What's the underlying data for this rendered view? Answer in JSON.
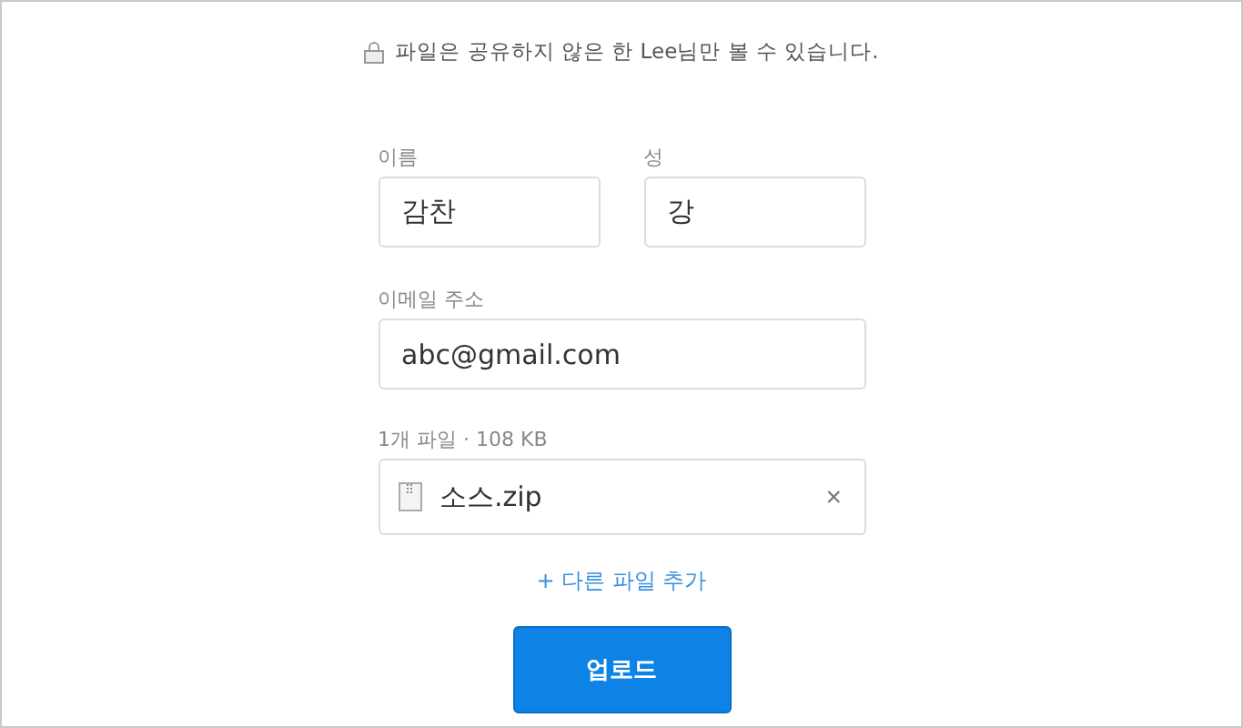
{
  "notice": "파일은 공유하지 않은 한 Lee님만 볼 수 있습니다.",
  "name_fields": [
    {
      "label": "이름",
      "value": "감찬"
    },
    {
      "label": "성",
      "value": "강"
    }
  ],
  "email_field": {
    "label": "이메일 주소",
    "value": "abc@gmail.com"
  },
  "files": {
    "summary": "1개 파일 · 108 KB",
    "items": [
      {
        "name": "소스.zip",
        "remove": "×"
      }
    ]
  },
  "add_file_link": "+ 다른 파일 추가",
  "upload_button": "업로드"
}
